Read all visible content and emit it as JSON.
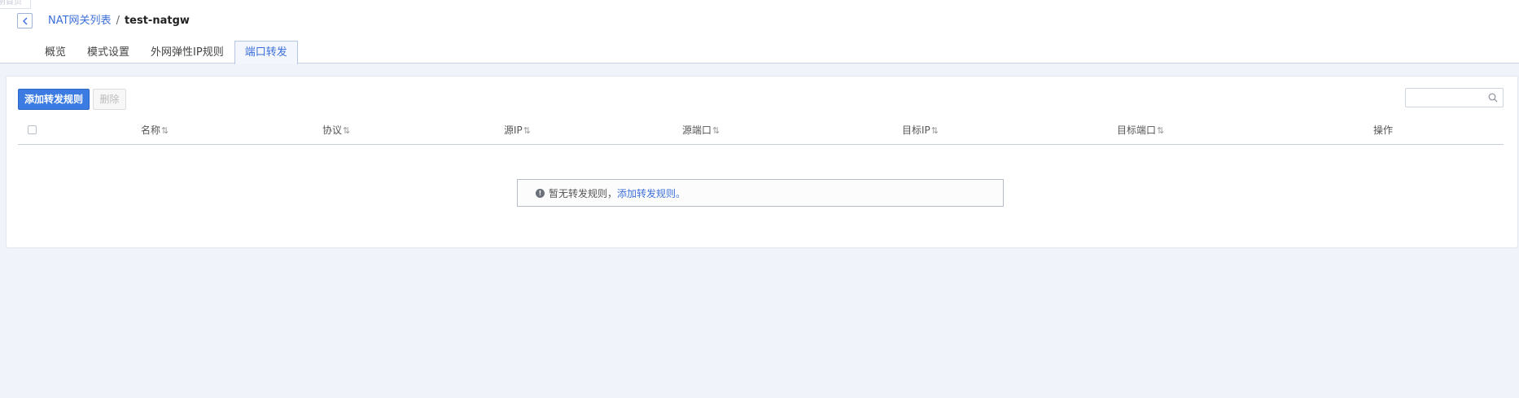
{
  "top": {
    "ghost_tab": "前首页",
    "breadcrumb": {
      "parent": "NAT网关列表",
      "separator": "/",
      "current": "test-natgw"
    }
  },
  "tabs": [
    {
      "label": "概览",
      "active": false
    },
    {
      "label": "模式设置",
      "active": false
    },
    {
      "label": "外网弹性IP规则",
      "active": false
    },
    {
      "label": "端口转发",
      "active": true
    }
  ],
  "toolbar": {
    "add_label": "添加转发规则",
    "delete_label": "删除",
    "search_placeholder": ""
  },
  "table": {
    "columns": [
      {
        "label": "名称",
        "sortable": true
      },
      {
        "label": "协议",
        "sortable": true
      },
      {
        "label": "源IP",
        "sortable": true
      },
      {
        "label": "源端口",
        "sortable": true
      },
      {
        "label": "目标IP",
        "sortable": true
      },
      {
        "label": "目标端口",
        "sortable": true
      },
      {
        "label": "操作",
        "sortable": false
      }
    ],
    "sort_glyph": "⇅",
    "rows": []
  },
  "empty_state": {
    "message": "暂无转发规则，",
    "link": "添加转发规则",
    "period": "。",
    "icon": "!"
  },
  "colors": {
    "primary": "#3c7ce2",
    "link": "#3b6fd9",
    "page_background": "#f0f3fa"
  }
}
